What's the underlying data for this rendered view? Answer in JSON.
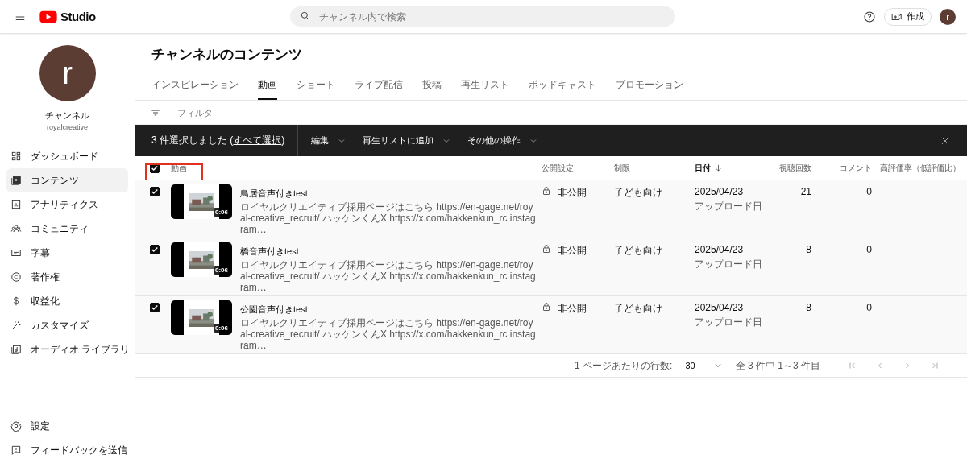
{
  "header": {
    "logo_text": "Studio",
    "search": {
      "placeholder": "チャンネル内で検索"
    },
    "create_button": "作成",
    "account_initial": "r"
  },
  "sidebar": {
    "channel": {
      "initial": "r",
      "name": "チャンネル",
      "handle": "royalcreative"
    },
    "items": [
      {
        "label": "ダッシュボード",
        "selected": false
      },
      {
        "label": "コンテンツ",
        "selected": true
      },
      {
        "label": "アナリティクス",
        "selected": false
      },
      {
        "label": "コミュニティ",
        "selected": false
      },
      {
        "label": "字幕",
        "selected": false
      },
      {
        "label": "著作権",
        "selected": false
      },
      {
        "label": "収益化",
        "selected": false
      },
      {
        "label": "カスタマイズ",
        "selected": false
      },
      {
        "label": "オーディオ ライブラリ",
        "selected": false
      }
    ],
    "footer_items": [
      {
        "label": "設定"
      },
      {
        "label": "フィードバックを送信"
      }
    ]
  },
  "page": {
    "title": "チャンネルのコンテンツ",
    "tabs": [
      {
        "label": "インスピレーション",
        "selected": false
      },
      {
        "label": "動画",
        "selected": true
      },
      {
        "label": "ショート",
        "selected": false
      },
      {
        "label": "ライブ配信",
        "selected": false
      },
      {
        "label": "投稿",
        "selected": false
      },
      {
        "label": "再生リスト",
        "selected": false
      },
      {
        "label": "ポッドキャスト",
        "selected": false
      },
      {
        "label": "プロモーション",
        "selected": false
      }
    ],
    "filter": {
      "placeholder": "フィルタ"
    },
    "selection_bar": {
      "count_text": "3 件選択しました (",
      "select_all": "すべて選択",
      "count_suffix": ")",
      "actions": [
        "編集",
        "再生リストに追加",
        "その他の操作"
      ]
    },
    "table": {
      "header_checked": true,
      "columns": [
        {
          "label": "動画",
          "highlighted": true,
          "sorted": false
        },
        {
          "label": "公開設定",
          "highlighted": false,
          "sorted": false
        },
        {
          "label": "制限",
          "highlighted": false,
          "sorted": false
        },
        {
          "label": "日付",
          "highlighted": false,
          "sorted": true
        },
        {
          "label": "視聴回数",
          "highlighted": false,
          "sorted": false
        },
        {
          "label": "コメント",
          "highlighted": false,
          "sorted": false
        },
        {
          "label": "高評価率（低評価比）",
          "highlighted": false,
          "sorted": false
        }
      ],
      "rows": [
        {
          "checked": true,
          "title": "鳥居音声付きtest",
          "description": "ロイヤルクリエイティブ採用ページはこちら https://en-gage.net/royal-creative_recruit/ ハッケンくんX https://x.com/hakkenkun_rc instagram…",
          "duration": "0:06",
          "visibility": "非公開",
          "restriction": "子ども向け",
          "date": "2025/04/23",
          "date_note": "アップロード日",
          "views": "21",
          "comments": "0",
          "rating": "–"
        },
        {
          "checked": true,
          "title": "橋音声付きtest",
          "description": "ロイヤルクリエイティブ採用ページはこちら https://en-gage.net/royal-creative_recruit/ ハッケンくんX https://x.com/hakkenkun_rc instagram…",
          "duration": "0:06",
          "visibility": "非公開",
          "restriction": "子ども向け",
          "date": "2025/04/23",
          "date_note": "アップロード日",
          "views": "8",
          "comments": "0",
          "rating": "–"
        },
        {
          "checked": true,
          "title": "公園音声付きtest",
          "description": "ロイヤルクリエイティブ採用ページはこちら https://en-gage.net/royal-creative_recruit/ ハッケンくんX https://x.com/hakkenkun_rc instagram…",
          "duration": "0:06",
          "visibility": "非公開",
          "restriction": "子ども向け",
          "date": "2025/04/23",
          "date_note": "アップロード日",
          "views": "8",
          "comments": "0",
          "rating": "–"
        }
      ]
    },
    "pagination": {
      "rows_per_page_label": "1 ページあたりの行数:",
      "rows_per_page": "30",
      "range": "全 3 件中 1～3 件目",
      "nav_disabled": true
    }
  }
}
